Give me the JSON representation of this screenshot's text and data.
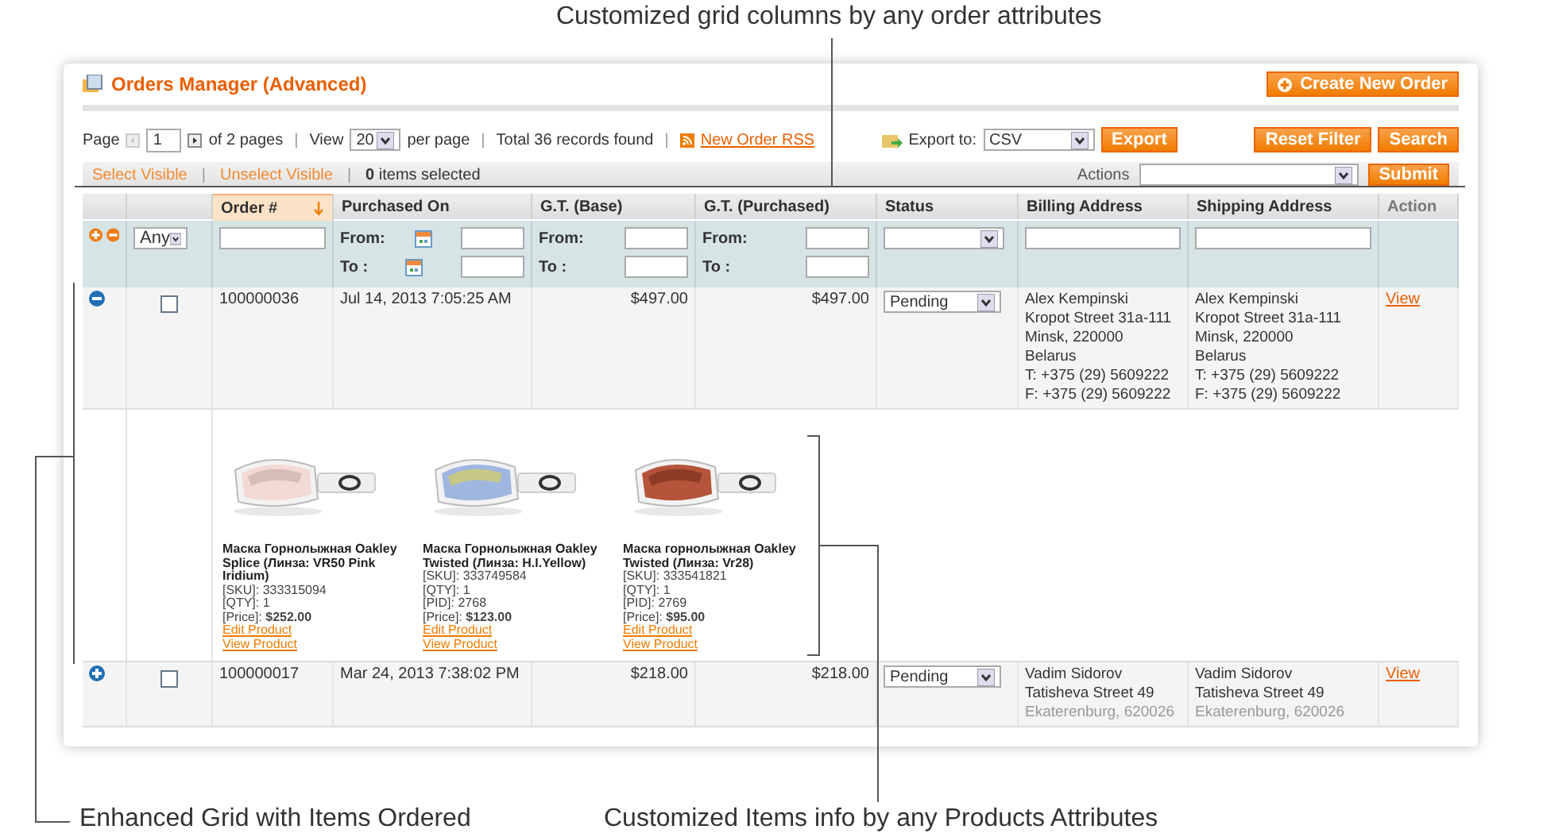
{
  "callouts": {
    "top": "Customized grid columns by any order attributes",
    "bottom_left": "Enhanced Grid with Items Ordered",
    "bottom_right": "Customized Items info by any Products Attributes"
  },
  "header": {
    "title": "Orders Manager (Advanced)",
    "create_button": "Create New Order"
  },
  "pager": {
    "page_label": "Page",
    "page_value": "1",
    "of_pages": "of 2 pages",
    "view_label": "View",
    "per_page": "20",
    "per_page_label": "per page",
    "total": "Total 36 records found",
    "rss_link": "New Order RSS",
    "export_label": "Export to:",
    "export_format": "CSV",
    "export_button": "Export",
    "reset_button": "Reset Filter",
    "search_button": "Search",
    "separators": [
      "|",
      "|",
      "|"
    ]
  },
  "massaction": {
    "select_visible": "Select Visible",
    "unselect_visible": "Unselect Visible",
    "count": "**0** items selected",
    "actions_label": "Actions",
    "submit_button": "Submit",
    "separators": [
      "|",
      "|"
    ]
  },
  "columns": [
    {
      "sorted": false,
      "filter": {
        "kind": "expand_icons"
      }
    },
    {
      "sorted": false,
      "filter": {
        "kind": "select",
        "value": "Any"
      }
    },
    {
      "label": "Order #",
      "sortable": true,
      "sorted": true,
      "filter": {
        "kind": "text"
      }
    },
    {
      "label": "Purchased On",
      "sortable": true,
      "sorted": false,
      "filter": {
        "kind": "date_range",
        "from_label": "From:",
        "to_label": "To :"
      }
    },
    {
      "label": "G.T. (Base)",
      "sortable": true,
      "sorted": false,
      "filter": {
        "kind": "range",
        "from_label": "From:",
        "to_label": "To :"
      }
    },
    {
      "label": "G.T. (Purchased)",
      "sortable": true,
      "sorted": false,
      "filter": {
        "kind": "range",
        "from_label": "From:",
        "to_label": "To :"
      }
    },
    {
      "label": "Status",
      "sortable": true,
      "sorted": false,
      "filter": {
        "kind": "select"
      }
    },
    {
      "label": "Billing Address",
      "sortable": true,
      "sorted": false,
      "filter": {
        "kind": "text"
      }
    },
    {
      "label": "Shipping Address",
      "sortable": true,
      "sorted": false,
      "filter": {
        "kind": "text"
      }
    },
    {
      "label": "Action",
      "sortable": false,
      "sorted": false,
      "filter": {
        "kind": "none"
      }
    }
  ],
  "rows": [
    {
      "expanded": true,
      "checked": false,
      "order": "100000036",
      "purchased": "Jul 14, 2013 7:05:25 AM",
      "gt_base": "$497.00",
      "gt_purchased": "$497.00",
      "status": "Pending",
      "billing": [
        "Alex Kempinski",
        "Kropot Street 31a-111",
        "Minsk, 220000",
        "Belarus",
        "T: +375 (29) 5609222",
        "F: +375 (29) 5609222"
      ],
      "shipping": [
        "Alex Kempinski",
        "Kropot Street 31a-111",
        "Minsk, 220000",
        "Belarus",
        "T: +375 (29) 5609222",
        "F: +375 (29) 5609222"
      ],
      "action": "View",
      "items": [
        {
          "name": "Маска Горнолыжная Oakley Splice (Линза: VR50 Pink Iridium)",
          "details": [
            "[SKU]: 333315094",
            "[QTY]: 1",
            "[Price]: **$252.00**"
          ],
          "edit_link": "Edit Product",
          "view_link": "View Product"
        },
        {
          "name": "Маска Горнолыжная Oakley Twisted (Линза: H.I.Yellow)",
          "details": [
            "[SKU]: 333749584",
            "[QTY]: 1",
            "[PID]: 2768",
            "[Price]: **$123.00**"
          ],
          "edit_link": "Edit Product",
          "view_link": "View Product"
        },
        {
          "name": "Маска горнолыжная Oakley Twisted (Линза: Vr28)",
          "details": [
            "[SKU]: 333541821",
            "[QTY]: 1",
            "[PID]: 2769",
            "[Price]: **$95.00**"
          ],
          "edit_link": "Edit Product",
          "view_link": "View Product"
        }
      ]
    },
    {
      "expanded": false,
      "checked": false,
      "order": "100000017",
      "purchased": "Mar 24, 2013 7:38:02 PM",
      "gt_base": "$218.00",
      "gt_purchased": "$218.00",
      "status": "Pending",
      "billing": [
        "Vadim Sidorov",
        "Tatisheva Street 49",
        "Ekaterenburg, 620026"
      ],
      "shipping": [
        "Vadim Sidorov",
        "Tatisheva Street 49",
        "Ekaterenburg, 620026"
      ],
      "action": "View"
    }
  ]
}
